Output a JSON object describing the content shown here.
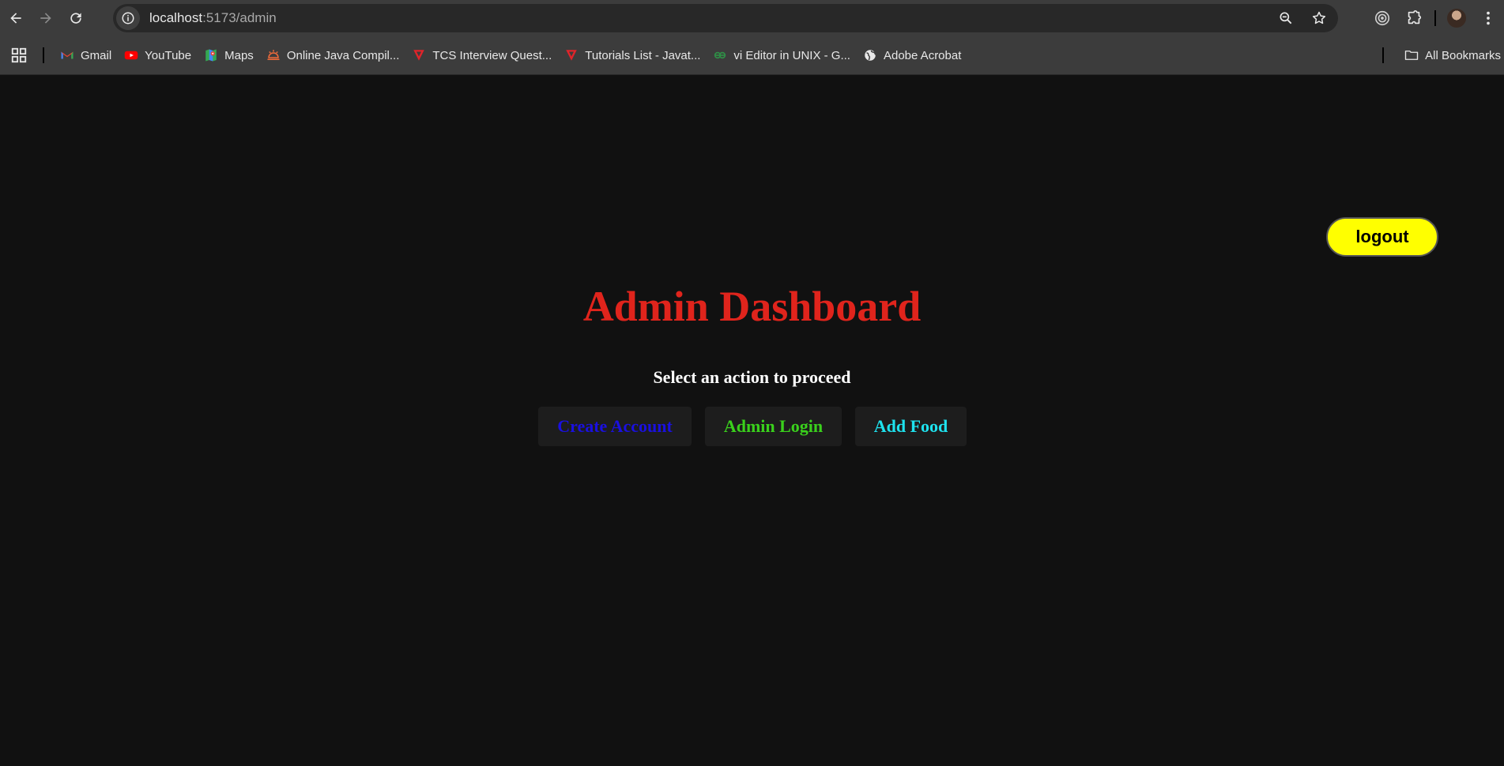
{
  "browser": {
    "url_host": "localhost",
    "url_path": ":5173/admin",
    "bookmarks": [
      {
        "label": "Gmail",
        "icon": "gmail-icon"
      },
      {
        "label": "YouTube",
        "icon": "youtube-icon"
      },
      {
        "label": "Maps",
        "icon": "maps-icon"
      },
      {
        "label": "Online Java Compil...",
        "icon": "compiler-icon"
      },
      {
        "label": "TCS Interview Quest...",
        "icon": "javatpoint-icon"
      },
      {
        "label": "Tutorials List - Javat...",
        "icon": "javatpoint-icon"
      },
      {
        "label": "vi Editor in UNIX - G...",
        "icon": "geeksforgeeks-icon"
      },
      {
        "label": "Adobe Acrobat",
        "icon": "globe-icon"
      }
    ],
    "all_bookmarks_label": "All Bookmarks"
  },
  "page": {
    "logout_label": "logout",
    "title": "Admin Dashboard",
    "subtitle": "Select an action to proceed",
    "actions": [
      {
        "label": "Create Account",
        "color": "#1a10e0"
      },
      {
        "label": "Admin Login",
        "color": "#3ad11c"
      },
      {
        "label": "Add Food",
        "color": "#1ee2ee"
      }
    ]
  },
  "colors": {
    "background": "#111111",
    "title": "#e0241c",
    "logout_bg": "#ffff00",
    "action_bg": "#1d1d1d"
  }
}
